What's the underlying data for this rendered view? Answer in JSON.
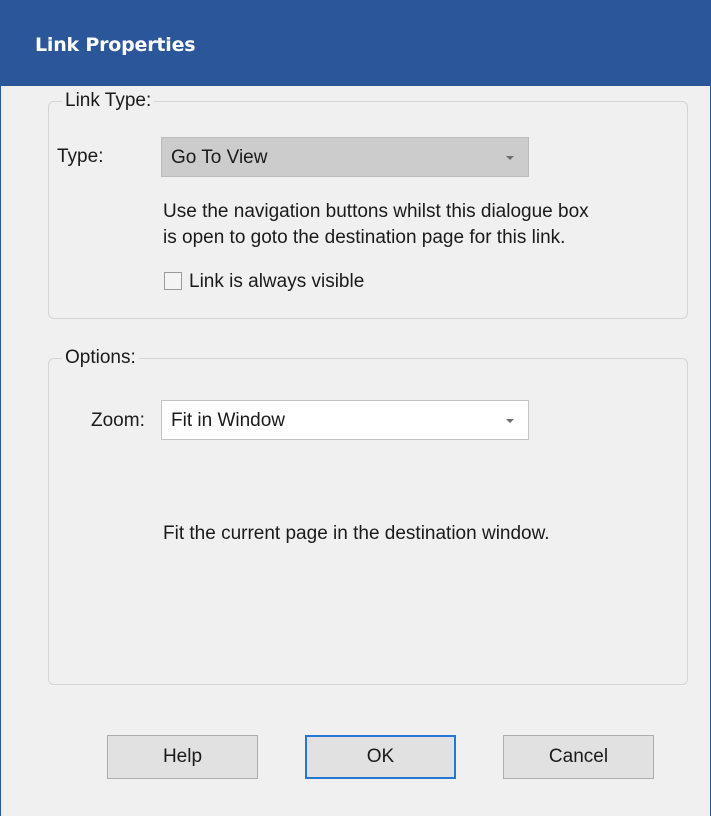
{
  "window": {
    "title": "Link Properties"
  },
  "link_type_group": {
    "legend": "Link Type:",
    "type_label": "Type:",
    "type_value": "Go To View",
    "description_line1": "Use the navigation buttons whilst this dialogue box",
    "description_line2": "is open to goto the destination page for this link.",
    "always_visible_label": "Link is always visible",
    "always_visible_checked": false
  },
  "options_group": {
    "legend": "Options:",
    "zoom_label": "Zoom:",
    "zoom_value": "Fit in Window",
    "description": "Fit the current page in the destination window."
  },
  "buttons": {
    "help": "Help",
    "ok": "OK",
    "cancel": "Cancel"
  },
  "colors": {
    "titlebar": "#2b579a",
    "dialog_bg": "#f0f0f0",
    "default_button_border": "#2677d4"
  }
}
